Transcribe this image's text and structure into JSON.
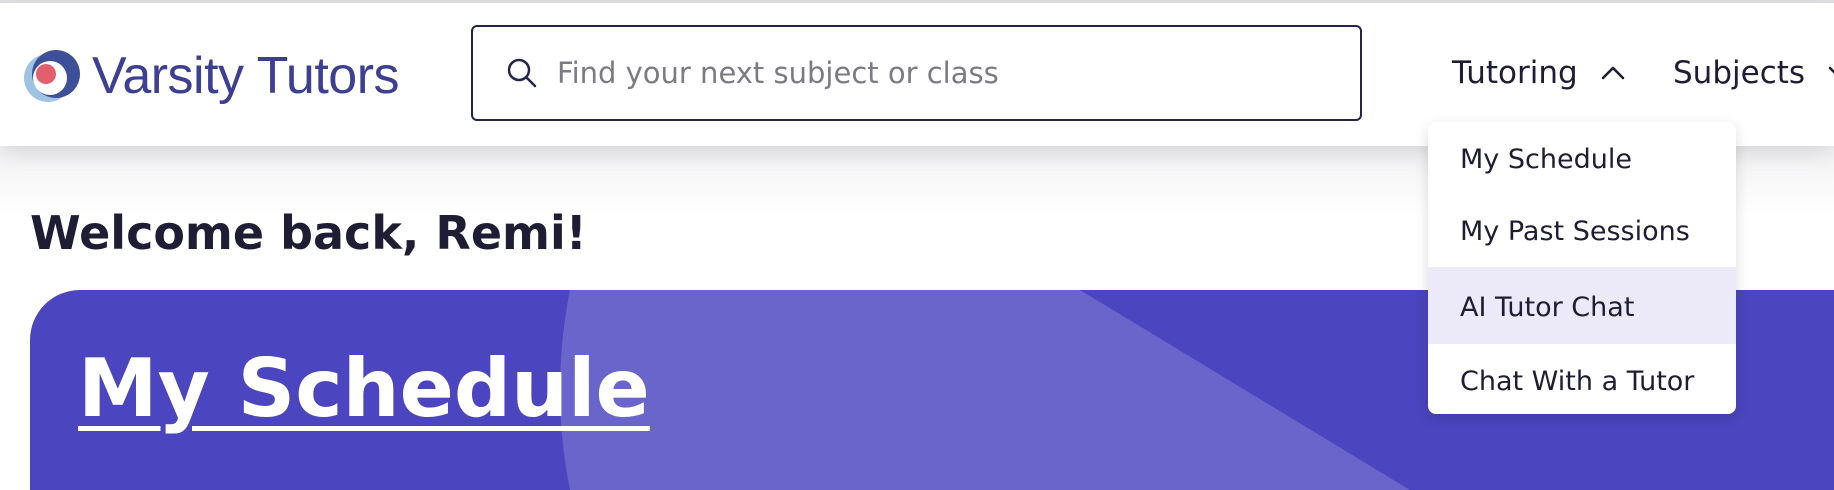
{
  "header": {
    "logo_text": "Varsity Tutors",
    "search": {
      "placeholder": "Find your next subject or class",
      "value": ""
    },
    "nav": {
      "tutoring": {
        "label": "Tutoring",
        "expanded": true
      },
      "subjects": {
        "label": "Subjects"
      }
    }
  },
  "tutoring_menu": {
    "items": [
      {
        "label": "My Schedule"
      },
      {
        "label": "My Past Sessions"
      },
      {
        "label": "AI Tutor Chat",
        "highlighted": true
      },
      {
        "label": "Chat With a Tutor"
      }
    ]
  },
  "main": {
    "welcome": "Welcome back, Remi!",
    "banner_title": "My Schedule"
  },
  "colors": {
    "brand_text": "#3d3f93",
    "banner_bg": "#4b45bf",
    "menu_highlight": "#eceaf8",
    "logo_red": "#e25f6e",
    "logo_blue": "#3e4f9a",
    "logo_light_blue": "#9fc3e2"
  },
  "icons": [
    "logo-mark-icon",
    "search-icon",
    "chevron-up-icon",
    "chevron-down-icon"
  ]
}
